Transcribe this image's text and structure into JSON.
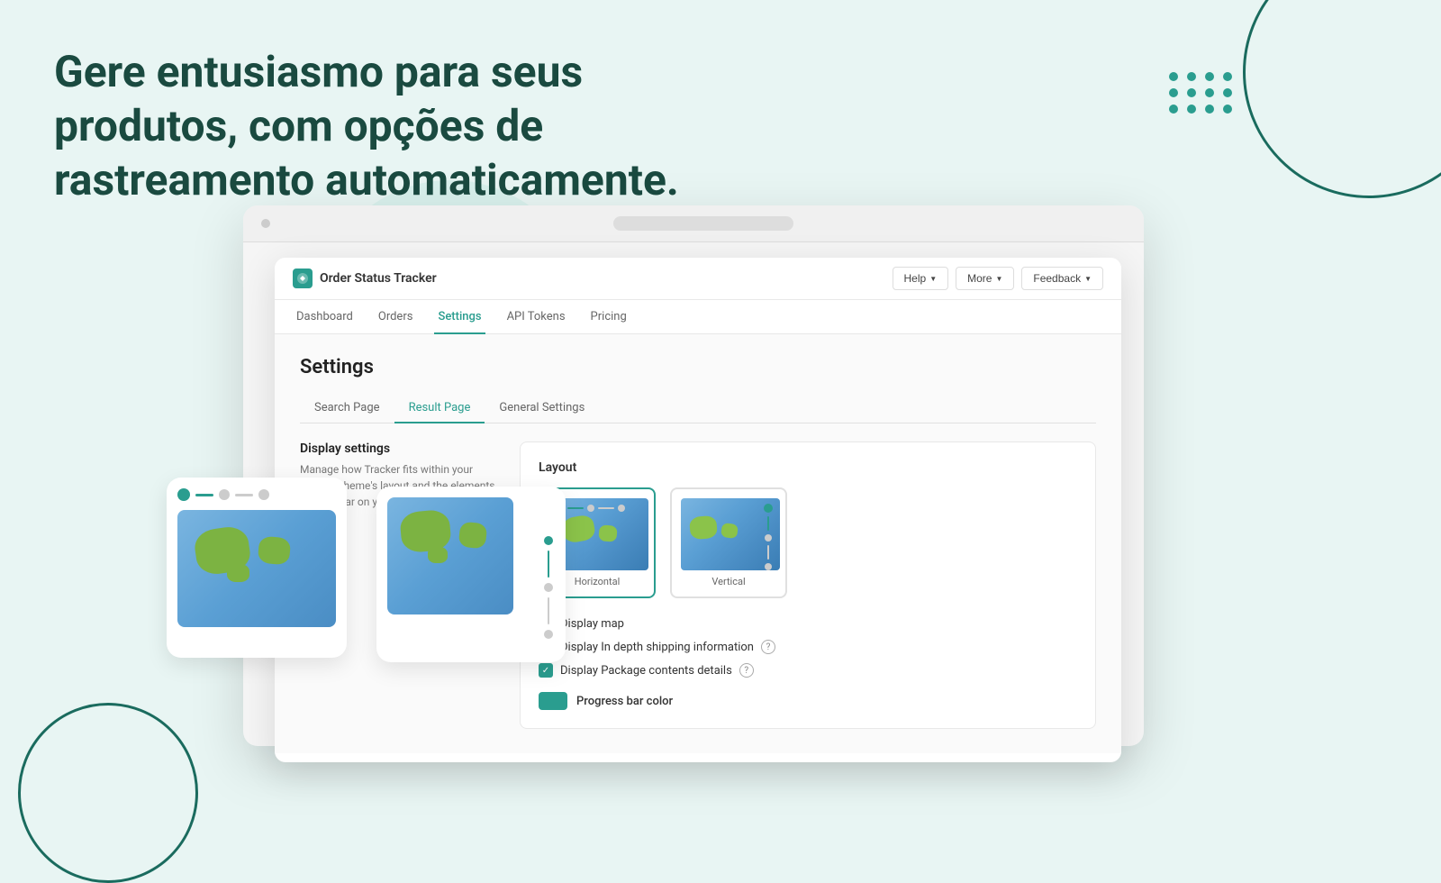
{
  "hero": {
    "text_line1": "Gere entusiasmo para seus produtos, com opções de",
    "text_line2": "rastreamento automaticamente."
  },
  "browser": {
    "bar_placeholder": ""
  },
  "app": {
    "brand_icon": "O",
    "brand_name": "Order Status Tracker",
    "header_buttons": [
      {
        "label": "Help",
        "id": "help"
      },
      {
        "label": "More",
        "id": "more"
      },
      {
        "label": "Feedback",
        "id": "feedback"
      }
    ],
    "nav_tabs": [
      {
        "label": "Dashboard",
        "active": false
      },
      {
        "label": "Orders",
        "active": false
      },
      {
        "label": "Settings",
        "active": true
      },
      {
        "label": "API Tokens",
        "active": false
      },
      {
        "label": "Pricing",
        "active": false
      }
    ],
    "settings": {
      "title": "Settings",
      "sub_tabs": [
        {
          "label": "Search Page",
          "active": false
        },
        {
          "label": "Result Page",
          "active": true
        },
        {
          "label": "General Settings",
          "active": false
        }
      ],
      "display_settings": {
        "title": "Display settings",
        "description": "Manage how Tracker fits within your existing theme's layout and the elements that appear on your tracking page."
      },
      "layout": {
        "title": "Layout",
        "options": [
          {
            "label": "Horizontal",
            "selected": true
          },
          {
            "label": "Vertical",
            "selected": false
          }
        ]
      },
      "checkboxes": [
        {
          "label": "Display map",
          "checked": true
        },
        {
          "label": "Display In depth shipping information",
          "checked": true,
          "has_info": true
        },
        {
          "label": "Display Package contents details",
          "checked": true,
          "has_info": true
        }
      ],
      "progress_bar": {
        "label": "Progress bar color"
      }
    }
  }
}
